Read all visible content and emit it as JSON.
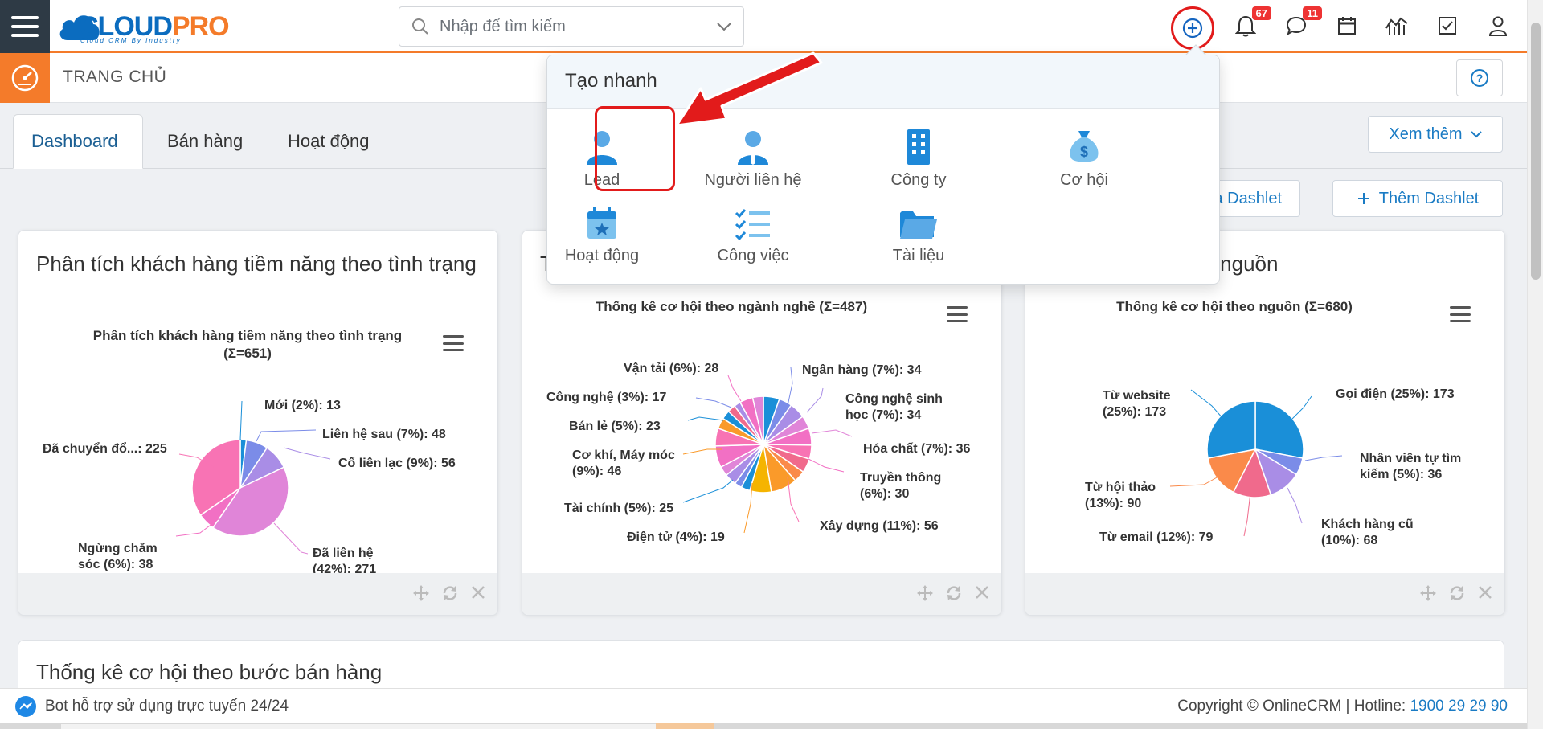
{
  "header": {
    "logo_main_a": "CLOUD",
    "logo_main_b": "PRO",
    "logo_sub": "Cloud CRM By Industry",
    "search_placeholder": "Nhập để tìm kiếm",
    "notifications_count": "67",
    "messages_count": "11"
  },
  "subbar": {
    "page_title": "TRANG CHỦ"
  },
  "tabs": [
    {
      "label": "Dashboard",
      "active": true
    },
    {
      "label": "Bán hàng",
      "active": false
    },
    {
      "label": "Hoạt động",
      "active": false
    }
  ],
  "actions": {
    "xem_them": "Xem thêm",
    "sap_xep": "Sắp xếp tất cả Dashlet",
    "sap_xep_visible": "ất cả Dashlet",
    "them_dashlet": "Thêm Dashlet"
  },
  "quick_create": {
    "title": "Tạo nhanh",
    "items": [
      {
        "label": "Lead",
        "icon": "person-icon"
      },
      {
        "label": "Người liên hệ",
        "icon": "contact-person-icon"
      },
      {
        "label": "Công ty",
        "icon": "building-icon"
      },
      {
        "label": "Cơ hội",
        "icon": "money-bag-icon"
      },
      {
        "label": "Hoạt động",
        "icon": "calendar-star-icon"
      },
      {
        "label": "Công việc",
        "icon": "checklist-icon"
      },
      {
        "label": "Tài liệu",
        "icon": "folder-icon"
      }
    ]
  },
  "dashlets": {
    "d1": {
      "title": "Phân tích khách hàng tiềm năng theo tình trạng",
      "chart_title_1": "Phân tích khách hàng tiềm năng theo tình trạng",
      "chart_title_2": "(Σ=651)"
    },
    "d2": {
      "title": "Thống kê cơ hội theo ngành nghề",
      "title_visible": "T",
      "chart_title": "Thống kê cơ hội theo ngành nghề (Σ=487)"
    },
    "d3": {
      "title": "Thống kê cơ hội theo nguồn",
      "title_visible": "eo nguồn",
      "chart_title": "Thống kê cơ hội theo nguồn (Σ=680)"
    }
  },
  "chart_data": [
    {
      "type": "pie",
      "title": "Phân tích khách hàng tiềm năng theo tình trạng (Σ=651)",
      "categories": [
        "Mới",
        "Liên hệ sau",
        "Cố liên lạc",
        "Đã liên hệ",
        "Ngừng chăm sóc",
        "Đã chuyển đổi"
      ],
      "values": [
        13,
        48,
        56,
        271,
        38,
        225
      ],
      "labels": [
        "Mới (2%): 13",
        "Liên hệ sau (7%): 48",
        "Cố liên lạc (9%): 56",
        "Đã liên hệ (42%): 271",
        "Ngừng chăm sóc (6%): 38",
        "Đã chuyển đổ...: 225"
      ],
      "colors": [
        "#1a8fd8",
        "#7b8ce8",
        "#a98de6",
        "#e085d8",
        "#f270c4",
        "#f873b4"
      ]
    },
    {
      "type": "pie",
      "title": "Thống kê cơ hội theo ngành nghề (Σ=487)",
      "categories": [
        "Ngân hàng",
        "Công nghệ sinh học",
        "Hóa chất",
        "Truyền thông",
        "Xây dựng",
        "Điện tử",
        "Tài chính",
        "Cơ khí, Máy móc",
        "Bán lẻ",
        "Công nghệ",
        "Vận tải"
      ],
      "values": [
        34,
        34,
        36,
        30,
        56,
        19,
        25,
        46,
        23,
        17,
        28
      ],
      "labels": [
        "Ngân hàng (7%): 34",
        "Công nghệ sinh học (7%): 34",
        "Hóa chất (7%): 36",
        "Truyền thông (6%): 30",
        "Xây dựng (11%): 56",
        "Điện tử (4%): 19",
        "Tài chính (5%): 25",
        "Cơ khí, Máy móc (9%): 46",
        "Bán lẻ (5%): 23",
        "Công nghệ (3%): 17",
        "Vận tải (6%): 28"
      ]
    },
    {
      "type": "pie",
      "title": "Thống kê cơ hội theo nguồn (Σ=680)",
      "categories": [
        "Gọi điện",
        "Nhân viên tự tìm kiếm",
        "Khách hàng cũ",
        "Từ email",
        "Từ hội thảo",
        "Từ website"
      ],
      "values": [
        173,
        36,
        68,
        79,
        90,
        173
      ],
      "labels": [
        "Gọi điện (25%): 173",
        "Nhân viên tự tìm kiếm (5%): 36",
        "Khách hàng cũ (10%): 68",
        "Từ email (12%): 79",
        "Từ hội thảo (13%): 90",
        "Từ website (25%): 173"
      ],
      "colors": [
        "#1a8fd8",
        "#7b8ce8",
        "#a98de6",
        "#f06a8c",
        "#fa8a4a",
        "#1a8fd8"
      ]
    }
  ],
  "bottom_card": {
    "title": "Thống kê cơ hội theo bước bán hàng"
  },
  "footer": {
    "chat_text": "Bot hỗ trợ sử dụng trực tuyến 24/24",
    "copyright": "Copyright © OnlineCRM | Hotline: ",
    "hotline": "1900 29 29 90"
  }
}
